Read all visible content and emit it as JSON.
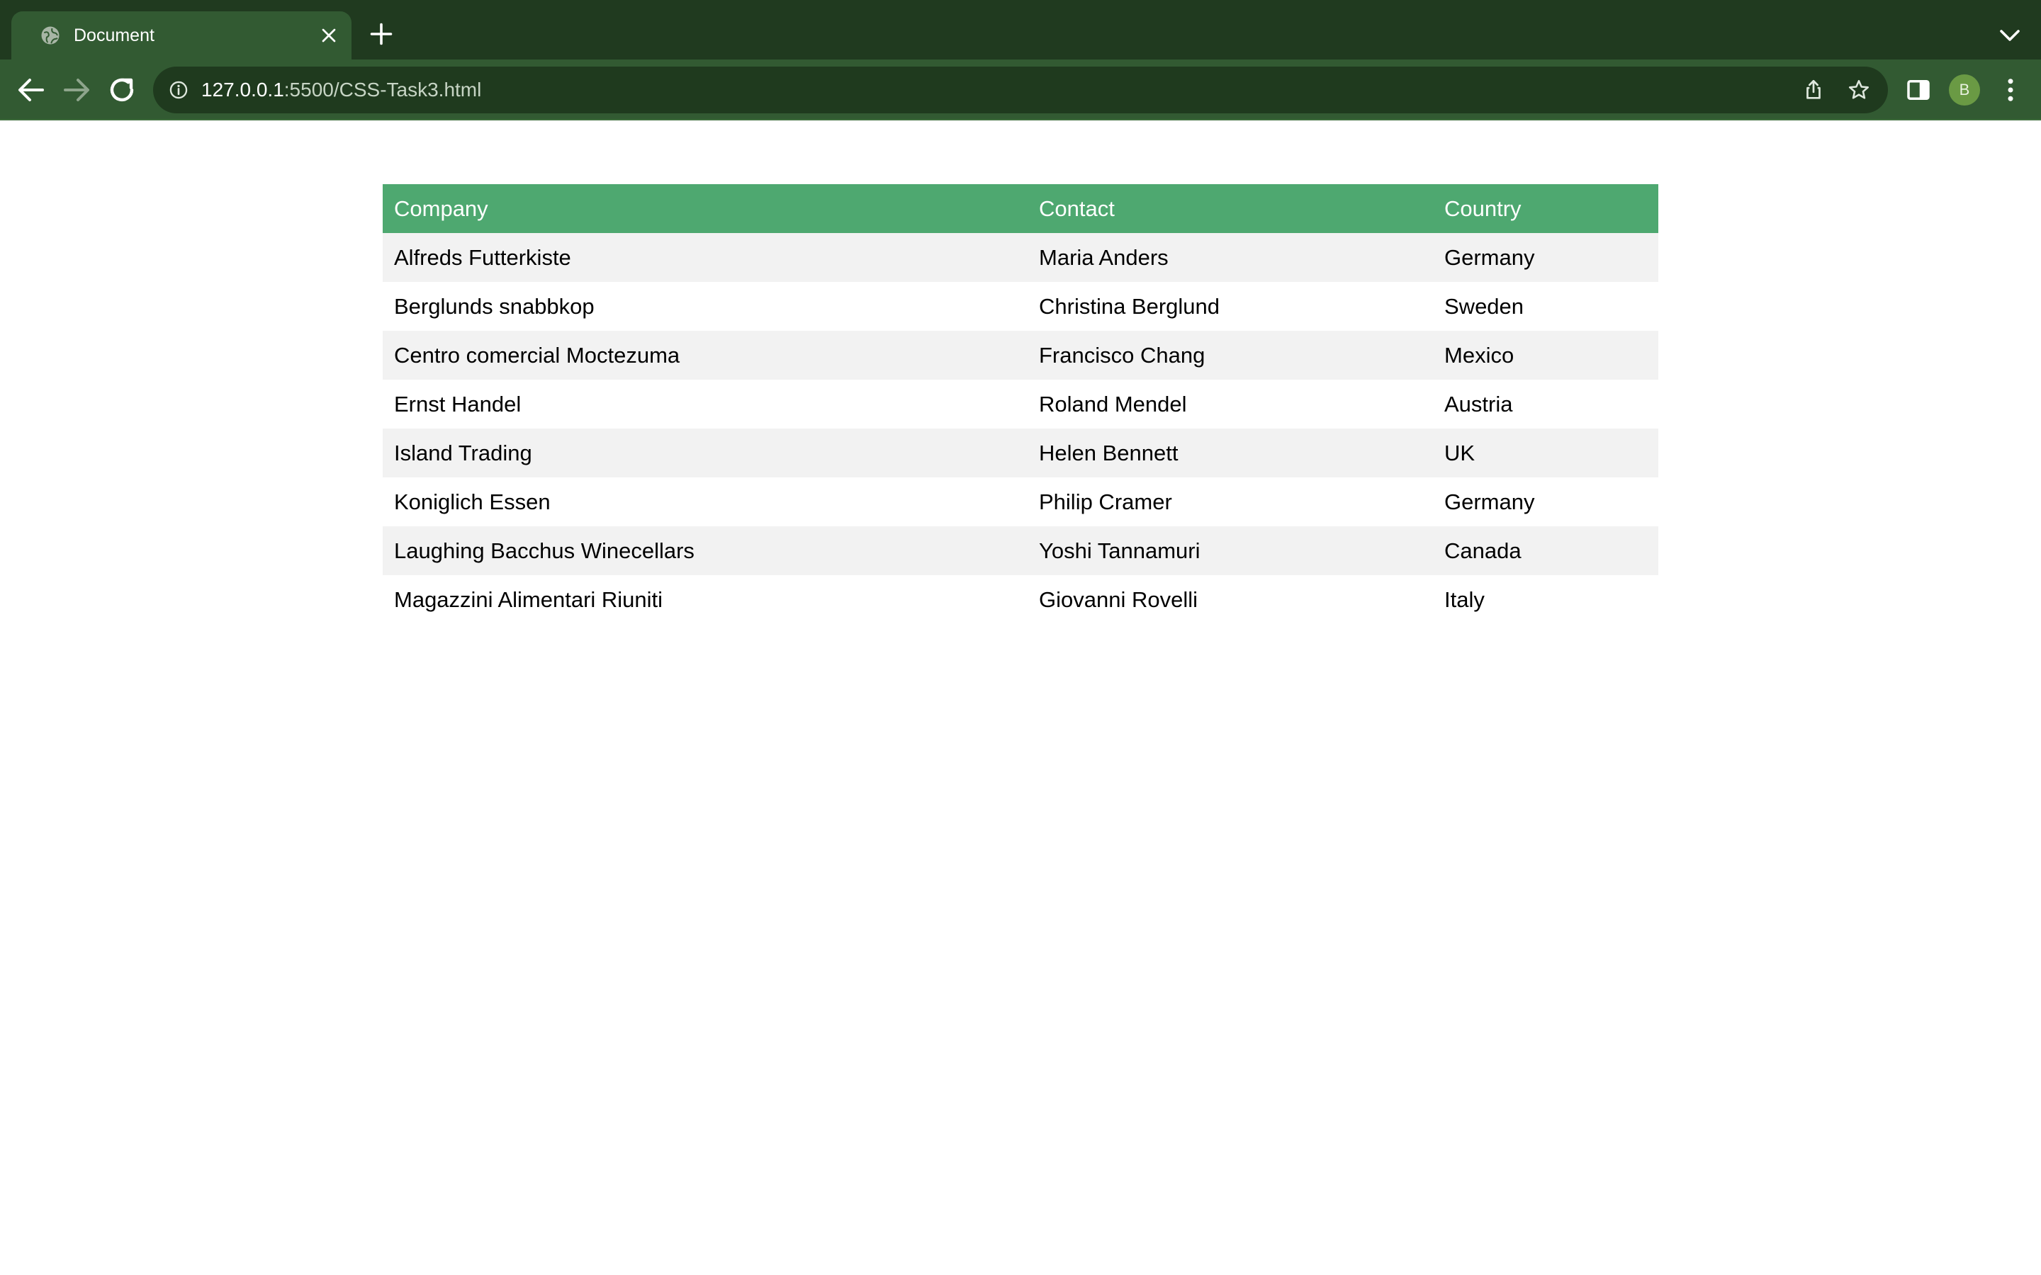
{
  "browser": {
    "tab": {
      "title": "Document",
      "favicon": "globe-icon",
      "close_icon": "close-icon"
    },
    "new_tab_icon": "plus-icon",
    "tab_search_icon": "chevron-down-icon",
    "toolbar": {
      "back_icon": "arrow-left-icon",
      "forward_icon": "arrow-right-icon",
      "reload_icon": "reload-icon",
      "site_info_icon": "info-icon",
      "url_host": "127.0.0.1",
      "url_rest": ":5500/CSS-Task3.html",
      "share_icon": "share-icon",
      "bookmark_icon": "star-icon",
      "side_panel_icon": "side-panel-icon",
      "profile_initial": "B",
      "menu_icon": "kebab-menu-icon"
    },
    "colors": {
      "tabstrip": "#203a1f",
      "toolbar": "#325a32",
      "omnibox": "#1f3a1e",
      "avatar": "#6a9a44"
    }
  },
  "table": {
    "headers": [
      "Company",
      "Contact",
      "Country"
    ],
    "rows": [
      [
        "Alfreds Futterkiste",
        "Maria Anders",
        "Germany"
      ],
      [
        "Berglunds snabbkop",
        "Christina Berglund",
        "Sweden"
      ],
      [
        "Centro comercial Moctezuma",
        "Francisco Chang",
        "Mexico"
      ],
      [
        "Ernst Handel",
        "Roland Mendel",
        "Austria"
      ],
      [
        "Island Trading",
        "Helen Bennett",
        "UK"
      ],
      [
        "Koniglich Essen",
        "Philip Cramer",
        "Germany"
      ],
      [
        "Laughing Bacchus Winecellars",
        "Yoshi Tannamuri",
        "Canada"
      ],
      [
        "Magazzini Alimentari Riuniti",
        "Giovanni Rovelli",
        "Italy"
      ]
    ],
    "colors": {
      "header_bg": "#4ea870",
      "header_text": "#ffffff",
      "stripe_bg": "#f2f2f2"
    }
  }
}
